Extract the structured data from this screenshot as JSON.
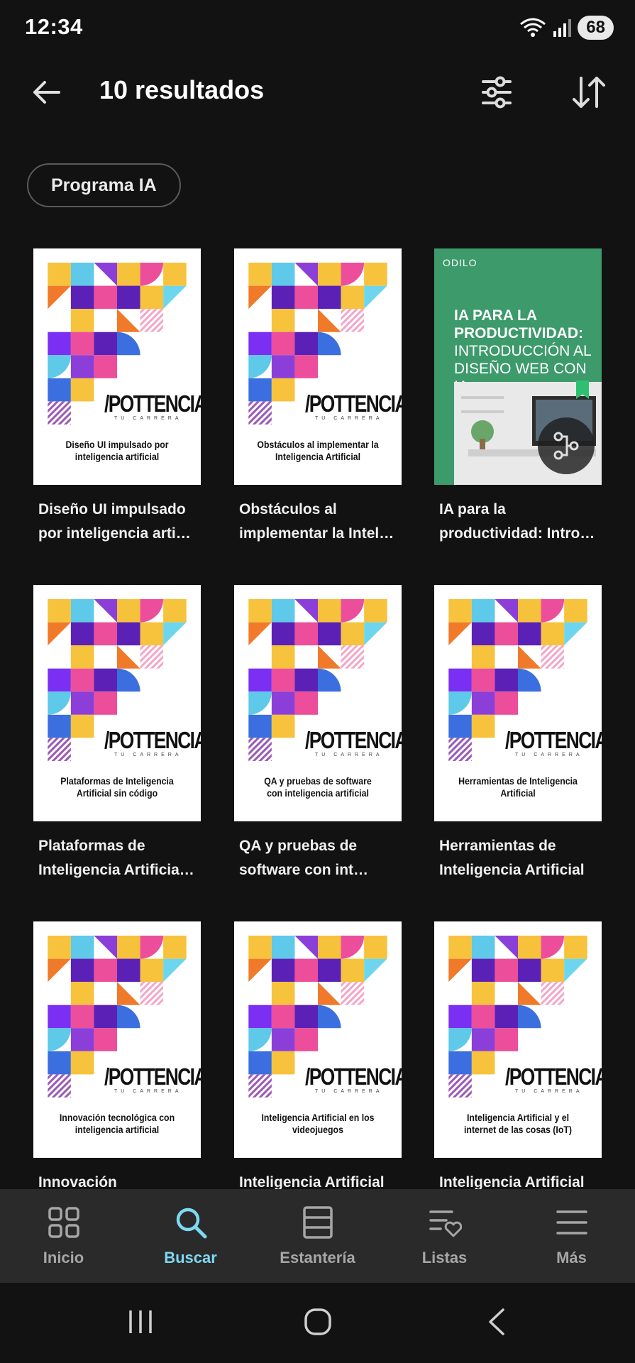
{
  "status": {
    "time": "12:34",
    "battery": "68"
  },
  "header": {
    "title": "10 resultados"
  },
  "chip": {
    "label": "Programa IA"
  },
  "brand": {
    "name": "/POTTENCIA",
    "sub": "TU CARRERA"
  },
  "green_book": {
    "brand": "ODILO",
    "title_line1": "IA PARA LA PRODUCTIVIDAD:",
    "title_line2": "INTRODUCCIÓN AL DISEÑO WEB CON IA"
  },
  "books": [
    {
      "cover_text": "Diseño UI impulsado por inteligencia artificial",
      "title": "Diseño UI impulsado por inteligencia arti…"
    },
    {
      "cover_text": "Obstáculos al implementar la Inteligencia Artificial",
      "title": "Obstáculos al implementar la Intel…"
    },
    {
      "cover_text": "",
      "title": "IA para la productividad: Intro…"
    },
    {
      "cover_text": "Plataformas de Inteligencia Artificial sin código",
      "title": "Plataformas de Inteligencia Artificia…"
    },
    {
      "cover_text": "QA y pruebas de software con inteligencia artificial",
      "title": "QA y pruebas de software con int…"
    },
    {
      "cover_text": "Herramientas de Inteligencia Artificial",
      "title": "Herramientas de Inteligencia Artificial"
    },
    {
      "cover_text": "Innovación tecnológica con inteligencia artificial",
      "title": "Innovación"
    },
    {
      "cover_text": "Inteligencia Artificial en los videojuegos",
      "title": "Inteligencia Artificial"
    },
    {
      "cover_text": "Inteligencia Artificial y el internet de las cosas (IoT)",
      "title": "Inteligencia Artificial"
    }
  ],
  "nav": {
    "items": [
      {
        "label": "Inicio",
        "icon": "grid-icon"
      },
      {
        "label": "Buscar",
        "icon": "search-icon",
        "active": true
      },
      {
        "label": "Estantería",
        "icon": "shelf-icon"
      },
      {
        "label": "Listas",
        "icon": "list-heart-icon"
      },
      {
        "label": "Más",
        "icon": "menu-icon"
      }
    ]
  },
  "colors": {
    "background": "#121212",
    "nav_bg": "#2a2a2a",
    "accent": "#7fd8f2",
    "green_cover": "#3d9a6b"
  }
}
